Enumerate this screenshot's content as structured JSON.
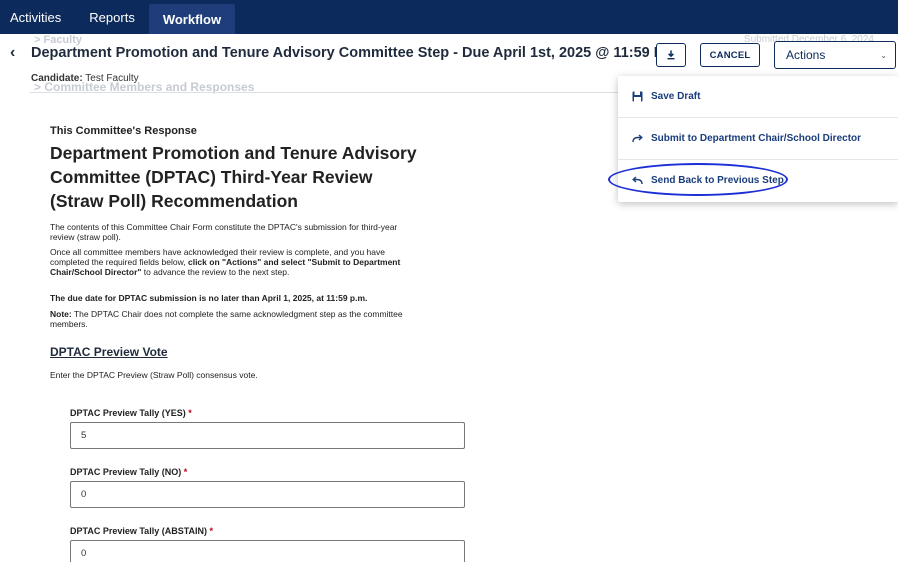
{
  "nav": {
    "tabs": [
      {
        "label": "Activities"
      },
      {
        "label": "Reports"
      },
      {
        "label": "Workflow"
      }
    ]
  },
  "header": {
    "ghost_faculty": "> Faculty",
    "ghost_submitted": "Submitted December 6, 2024",
    "title": "Department Promotion and Tenure Advisory Committee Step - Due April 1st, 2025 @ 11:59 PM",
    "candidate_label": "Candidate:",
    "candidate_value": "Test Faculty",
    "ghost_committee": "> Committee Members and Responses"
  },
  "toolbar": {
    "download_icon": "download-icon",
    "cancel_label": "CANCEL",
    "actions_label": "Actions"
  },
  "actions_menu": {
    "items": [
      {
        "label": "Save Draft",
        "icon": "save-icon"
      },
      {
        "label": "Submit to Department Chair/School Director",
        "icon": "forward-arrow-icon"
      },
      {
        "label": "Send Back to Previous Step",
        "icon": "back-arrow-icon"
      }
    ],
    "highlight_color": "#1b2fd6"
  },
  "main": {
    "section_label": "This Committee's Response",
    "form_title": "Department Promotion and Tenure Advisory Committee (DPTAC) Third-Year Review (Straw Poll) Recommendation",
    "p1": "The contents of this Committee Chair Form constitute the DPTAC's submission for third-year review (straw poll).",
    "p2_a": "Once all committee members have acknowledged their review is complete, and you have completed the required fields below, ",
    "p2_b": "click on \"Actions\" and select \"Submit to Department Chair/School Director\"",
    "p2_c": " to advance the review to the next step.",
    "p3": "The due date for DPTAC submission is no later than April 1, 2025, at 11:59 p.m.",
    "p4_label": "Note:",
    "p4_text": " The DPTAC Chair does not complete the same acknowledgment step as the committee members.",
    "vote_heading": "DPTAC Preview Vote",
    "vote_instruction": "Enter the DPTAC Preview (Straw Poll) consensus vote.",
    "fields": [
      {
        "label": "DPTAC Preview Tally (YES)",
        "required": "*",
        "value": "5"
      },
      {
        "label": "DPTAC Preview Tally (NO)",
        "required": "*",
        "value": "0"
      },
      {
        "label": "DPTAC Preview Tally (ABSTAIN)",
        "required": "*",
        "value": "0"
      }
    ]
  },
  "colors": {
    "nav_bg": "#0c2a5c",
    "accent": "#1a3d7c",
    "required": "#c0001a"
  }
}
